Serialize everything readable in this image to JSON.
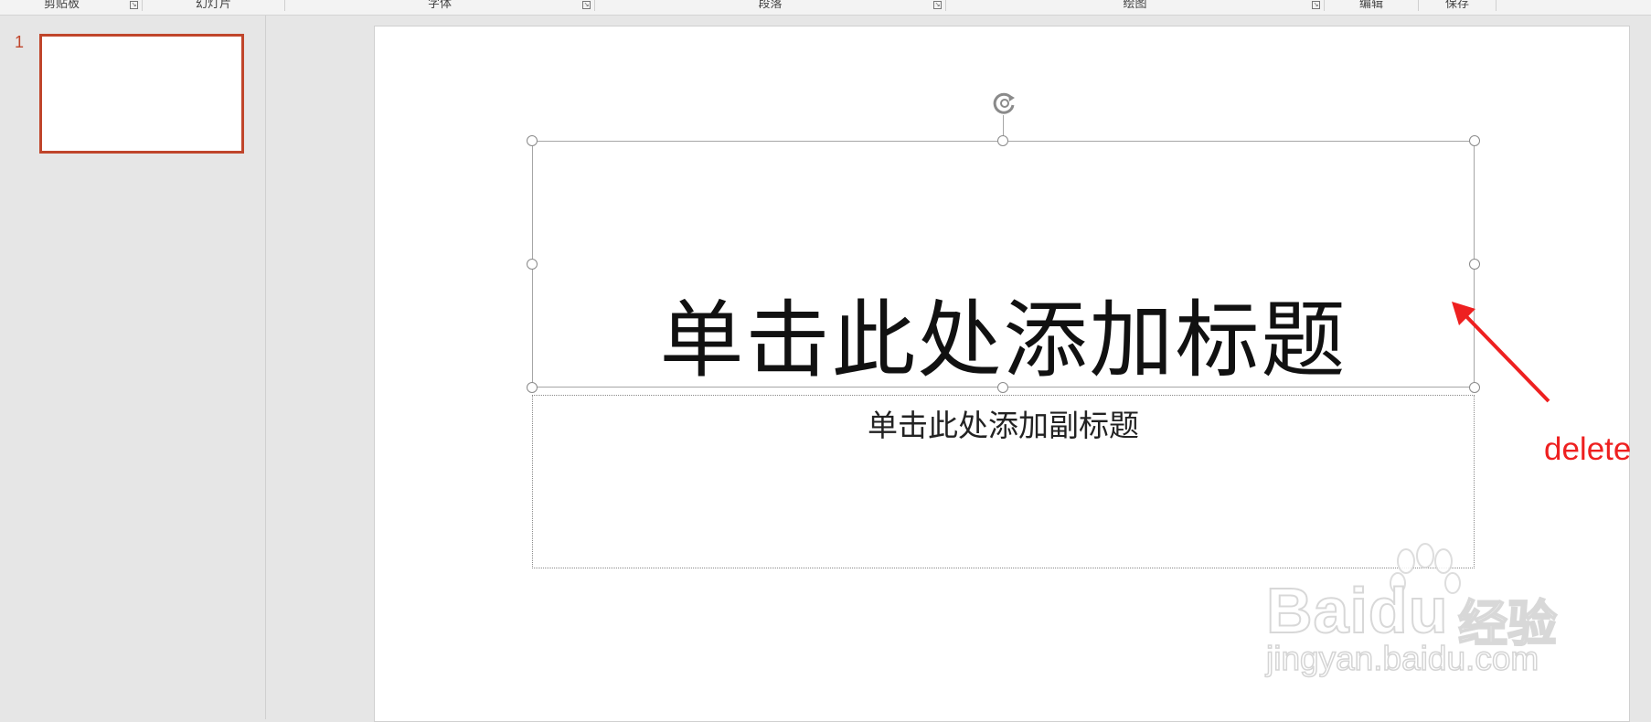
{
  "ribbon": {
    "groups": [
      {
        "label": "剪贴板",
        "launcher": "launcher-icon"
      },
      {
        "label": "幻灯片"
      },
      {
        "label": "字体",
        "launcher": "launcher-icon"
      },
      {
        "label": "段落",
        "launcher": "launcher-icon"
      },
      {
        "label": "绘图",
        "launcher": "launcher-icon"
      },
      {
        "label": "编辑"
      },
      {
        "label": "保存"
      }
    ]
  },
  "thumbnails": [
    {
      "number": "1"
    }
  ],
  "slide": {
    "title_placeholder": "单击此处添加标题",
    "subtitle_placeholder": "单击此处添加副标题"
  },
  "annotation": {
    "label": "delete",
    "color": "#ee2020"
  },
  "watermark": {
    "brand": "Baidu",
    "cn": "经验",
    "url": "jingyan.baidu.com"
  },
  "colors": {
    "accent": "#c0452b"
  },
  "icons": [
    "rotate-handle-icon",
    "launcher-icon",
    "arrow-icon"
  ]
}
